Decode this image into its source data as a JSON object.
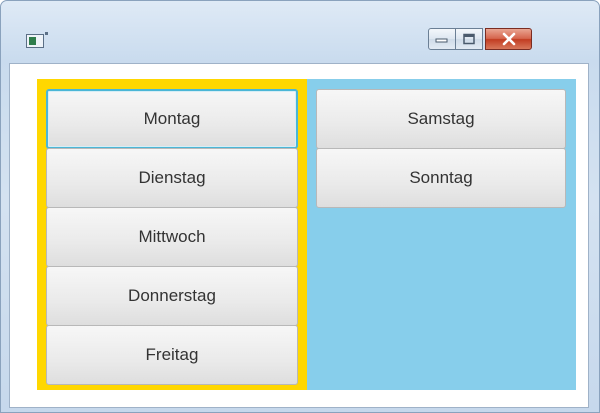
{
  "window": {
    "title": "",
    "controls": {
      "minimize_icon": "minimize-icon",
      "maximize_icon": "maximize-icon",
      "close_icon": "close-icon"
    }
  },
  "left_panel": {
    "background_color": "#ffd700",
    "buttons": [
      {
        "label": "Montag",
        "focused": true
      },
      {
        "label": "Dienstag",
        "focused": false
      },
      {
        "label": "Mittwoch",
        "focused": false
      },
      {
        "label": "Donnerstag",
        "focused": false
      },
      {
        "label": "Freitag",
        "focused": false
      }
    ]
  },
  "right_panel": {
    "background_color": "#87ceeb",
    "buttons": [
      {
        "label": "Samstag",
        "focused": false
      },
      {
        "label": "Sonntag",
        "focused": false
      }
    ]
  }
}
